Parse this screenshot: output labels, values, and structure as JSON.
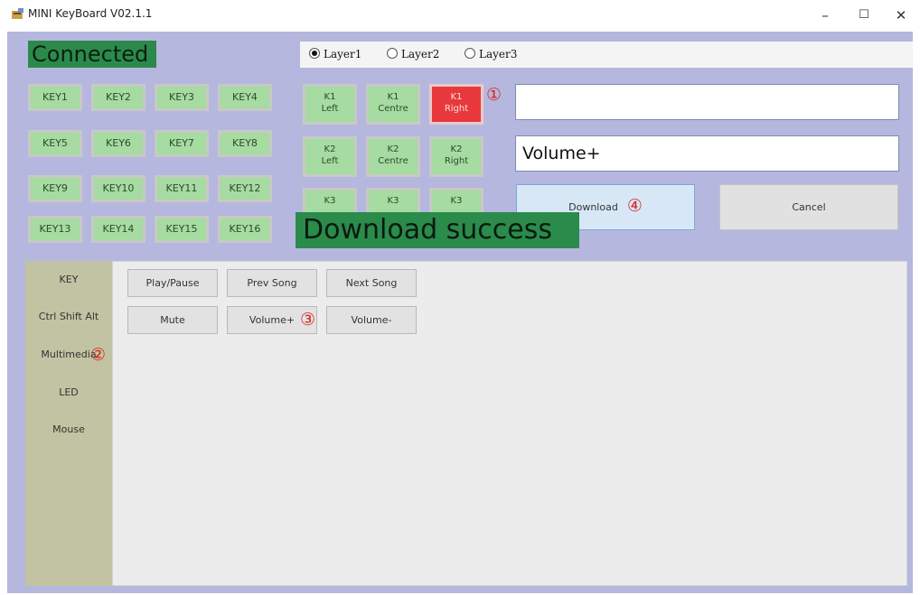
{
  "window": {
    "title": "MINI KeyBoard V02.1.1",
    "controls": {
      "minimize": "–",
      "maximize": "☐",
      "close": "✕"
    }
  },
  "status": {
    "text": "Connected"
  },
  "layers": {
    "options": [
      "Layer1",
      "Layer2",
      "Layer3"
    ],
    "selected": "Layer1"
  },
  "keys": [
    "KEY1",
    "KEY2",
    "KEY3",
    "KEY4",
    "KEY5",
    "KEY6",
    "KEY7",
    "KEY8",
    "KEY9",
    "KEY10",
    "KEY11",
    "KEY12",
    "KEY13",
    "KEY14",
    "KEY15",
    "KEY16"
  ],
  "knobs": [
    {
      "id": "K1",
      "left": "Left",
      "centre": "Centre",
      "right": "Right"
    },
    {
      "id": "K2",
      "left": "Left",
      "centre": "Centre",
      "right": "Right"
    },
    {
      "id": "K3",
      "left": "",
      "centre": "",
      "right": ""
    }
  ],
  "active_button": "K1 Right",
  "fields": {
    "field1": "",
    "field2": "Volume+"
  },
  "buttons": {
    "download": "Download",
    "cancel": "Cancel"
  },
  "banner": "Download success",
  "categories": [
    "KEY",
    "Ctrl Shift Alt",
    "Multimedia",
    "LED",
    "Mouse"
  ],
  "functions": [
    [
      "Play/Pause",
      "Prev Song",
      "Next Song"
    ],
    [
      "Mute",
      "Volume+",
      "Volume-"
    ]
  ],
  "markers": [
    "①",
    "②",
    "③",
    "④"
  ],
  "colors": {
    "client_bg": "#b6b7de",
    "key_green": "#a6dba1",
    "active_red": "#e8383b",
    "status_green": "#2b8a4b",
    "marker_red": "#d62820"
  }
}
